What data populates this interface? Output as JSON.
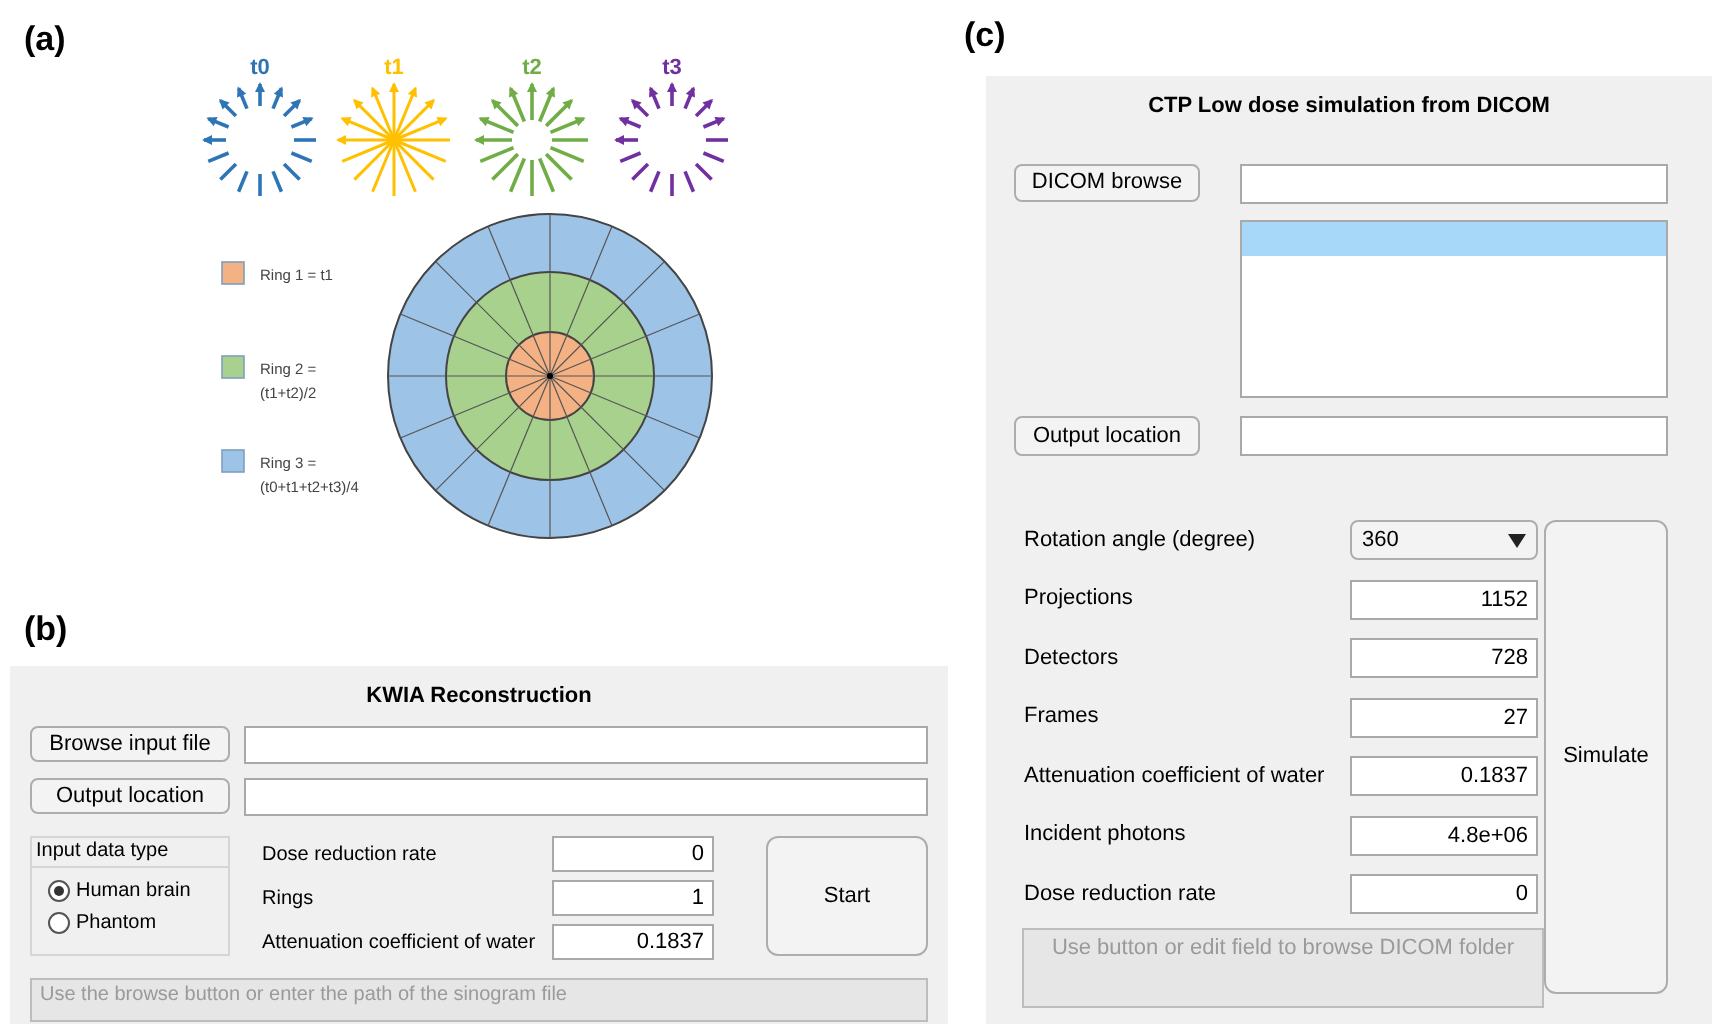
{
  "panel_a": {
    "label": "(a)",
    "timepoints": [
      {
        "label": "t0",
        "color": "#2e75b6",
        "kind": "dashed"
      },
      {
        "label": "t1",
        "color": "#ffc000",
        "kind": "full"
      },
      {
        "label": "t2",
        "color": "#70ad47",
        "kind": "hollow"
      },
      {
        "label": "t3",
        "color": "#7030a0",
        "kind": "dashed"
      }
    ],
    "legend": [
      {
        "lines": [
          "Ring 1 = t1"
        ],
        "color": "#f4b183"
      },
      {
        "lines": [
          "Ring 2 =",
          "(t1+t2)/2"
        ],
        "color": "#a9d18e"
      },
      {
        "lines": [
          "Ring 3 =",
          "(t0+t1+t2+t3)/4"
        ],
        "color": "#9dc3e6"
      }
    ]
  },
  "panel_b": {
    "label": "(b)",
    "title": "KWIA Reconstruction",
    "file_rows": [
      {
        "button": "Browse input file"
      },
      {
        "button": "Output location"
      }
    ],
    "input_data_type": {
      "title": "Input data type",
      "options": [
        {
          "label": "Human brain",
          "selected": true
        },
        {
          "label": "Phantom",
          "selected": false
        }
      ]
    },
    "params": [
      {
        "label": "Dose reduction rate",
        "value": "0"
      },
      {
        "label": "Rings",
        "value": "1"
      },
      {
        "label": "Attenuation coefficient of water",
        "value": "0.1837"
      }
    ],
    "start_button": "Start",
    "status": "Use the browse button or enter the path of the sinogram file"
  },
  "panel_c": {
    "label": "(c)",
    "title": "CTP Low dose simulation from DICOM",
    "dicom_button": "DICOM browse",
    "list_rows": [
      {
        "selected": true
      }
    ],
    "output_button": "Output location",
    "rotation": {
      "label": "Rotation angle (degree)",
      "value": "360"
    },
    "params": [
      {
        "label": "Projections",
        "value": "1152"
      },
      {
        "label": "Detectors",
        "value": "728"
      },
      {
        "label": "Frames",
        "value": "27"
      },
      {
        "label": "Attenuation coefficient of water",
        "value": "0.1837"
      },
      {
        "label": "Incident photons",
        "value": "4.8e+06"
      },
      {
        "label": "Dose reduction rate",
        "value": "0"
      }
    ],
    "simulate_button": "Simulate",
    "status": "Use button or edit field to browse DICOM folder"
  }
}
